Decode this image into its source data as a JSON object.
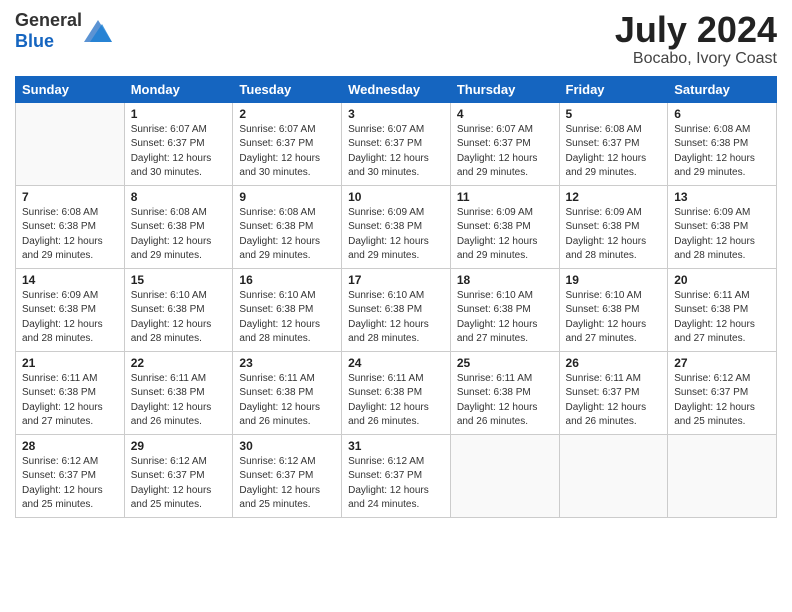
{
  "header": {
    "logo_general": "General",
    "logo_blue": "Blue",
    "month_year": "July 2024",
    "location": "Bocabo, Ivory Coast"
  },
  "days_of_week": [
    "Sunday",
    "Monday",
    "Tuesday",
    "Wednesday",
    "Thursday",
    "Friday",
    "Saturday"
  ],
  "weeks": [
    [
      {
        "day": "",
        "info": ""
      },
      {
        "day": "1",
        "info": "Sunrise: 6:07 AM\nSunset: 6:37 PM\nDaylight: 12 hours\nand 30 minutes."
      },
      {
        "day": "2",
        "info": "Sunrise: 6:07 AM\nSunset: 6:37 PM\nDaylight: 12 hours\nand 30 minutes."
      },
      {
        "day": "3",
        "info": "Sunrise: 6:07 AM\nSunset: 6:37 PM\nDaylight: 12 hours\nand 30 minutes."
      },
      {
        "day": "4",
        "info": "Sunrise: 6:07 AM\nSunset: 6:37 PM\nDaylight: 12 hours\nand 29 minutes."
      },
      {
        "day": "5",
        "info": "Sunrise: 6:08 AM\nSunset: 6:37 PM\nDaylight: 12 hours\nand 29 minutes."
      },
      {
        "day": "6",
        "info": "Sunrise: 6:08 AM\nSunset: 6:38 PM\nDaylight: 12 hours\nand 29 minutes."
      }
    ],
    [
      {
        "day": "7",
        "info": "Sunrise: 6:08 AM\nSunset: 6:38 PM\nDaylight: 12 hours\nand 29 minutes."
      },
      {
        "day": "8",
        "info": "Sunrise: 6:08 AM\nSunset: 6:38 PM\nDaylight: 12 hours\nand 29 minutes."
      },
      {
        "day": "9",
        "info": "Sunrise: 6:08 AM\nSunset: 6:38 PM\nDaylight: 12 hours\nand 29 minutes."
      },
      {
        "day": "10",
        "info": "Sunrise: 6:09 AM\nSunset: 6:38 PM\nDaylight: 12 hours\nand 29 minutes."
      },
      {
        "day": "11",
        "info": "Sunrise: 6:09 AM\nSunset: 6:38 PM\nDaylight: 12 hours\nand 29 minutes."
      },
      {
        "day": "12",
        "info": "Sunrise: 6:09 AM\nSunset: 6:38 PM\nDaylight: 12 hours\nand 28 minutes."
      },
      {
        "day": "13",
        "info": "Sunrise: 6:09 AM\nSunset: 6:38 PM\nDaylight: 12 hours\nand 28 minutes."
      }
    ],
    [
      {
        "day": "14",
        "info": "Sunrise: 6:09 AM\nSunset: 6:38 PM\nDaylight: 12 hours\nand 28 minutes."
      },
      {
        "day": "15",
        "info": "Sunrise: 6:10 AM\nSunset: 6:38 PM\nDaylight: 12 hours\nand 28 minutes."
      },
      {
        "day": "16",
        "info": "Sunrise: 6:10 AM\nSunset: 6:38 PM\nDaylight: 12 hours\nand 28 minutes."
      },
      {
        "day": "17",
        "info": "Sunrise: 6:10 AM\nSunset: 6:38 PM\nDaylight: 12 hours\nand 28 minutes."
      },
      {
        "day": "18",
        "info": "Sunrise: 6:10 AM\nSunset: 6:38 PM\nDaylight: 12 hours\nand 27 minutes."
      },
      {
        "day": "19",
        "info": "Sunrise: 6:10 AM\nSunset: 6:38 PM\nDaylight: 12 hours\nand 27 minutes."
      },
      {
        "day": "20",
        "info": "Sunrise: 6:11 AM\nSunset: 6:38 PM\nDaylight: 12 hours\nand 27 minutes."
      }
    ],
    [
      {
        "day": "21",
        "info": "Sunrise: 6:11 AM\nSunset: 6:38 PM\nDaylight: 12 hours\nand 27 minutes."
      },
      {
        "day": "22",
        "info": "Sunrise: 6:11 AM\nSunset: 6:38 PM\nDaylight: 12 hours\nand 26 minutes."
      },
      {
        "day": "23",
        "info": "Sunrise: 6:11 AM\nSunset: 6:38 PM\nDaylight: 12 hours\nand 26 minutes."
      },
      {
        "day": "24",
        "info": "Sunrise: 6:11 AM\nSunset: 6:38 PM\nDaylight: 12 hours\nand 26 minutes."
      },
      {
        "day": "25",
        "info": "Sunrise: 6:11 AM\nSunset: 6:38 PM\nDaylight: 12 hours\nand 26 minutes."
      },
      {
        "day": "26",
        "info": "Sunrise: 6:11 AM\nSunset: 6:37 PM\nDaylight: 12 hours\nand 26 minutes."
      },
      {
        "day": "27",
        "info": "Sunrise: 6:12 AM\nSunset: 6:37 PM\nDaylight: 12 hours\nand 25 minutes."
      }
    ],
    [
      {
        "day": "28",
        "info": "Sunrise: 6:12 AM\nSunset: 6:37 PM\nDaylight: 12 hours\nand 25 minutes."
      },
      {
        "day": "29",
        "info": "Sunrise: 6:12 AM\nSunset: 6:37 PM\nDaylight: 12 hours\nand 25 minutes."
      },
      {
        "day": "30",
        "info": "Sunrise: 6:12 AM\nSunset: 6:37 PM\nDaylight: 12 hours\nand 25 minutes."
      },
      {
        "day": "31",
        "info": "Sunrise: 6:12 AM\nSunset: 6:37 PM\nDaylight: 12 hours\nand 24 minutes."
      },
      {
        "day": "",
        "info": ""
      },
      {
        "day": "",
        "info": ""
      },
      {
        "day": "",
        "info": ""
      }
    ]
  ]
}
